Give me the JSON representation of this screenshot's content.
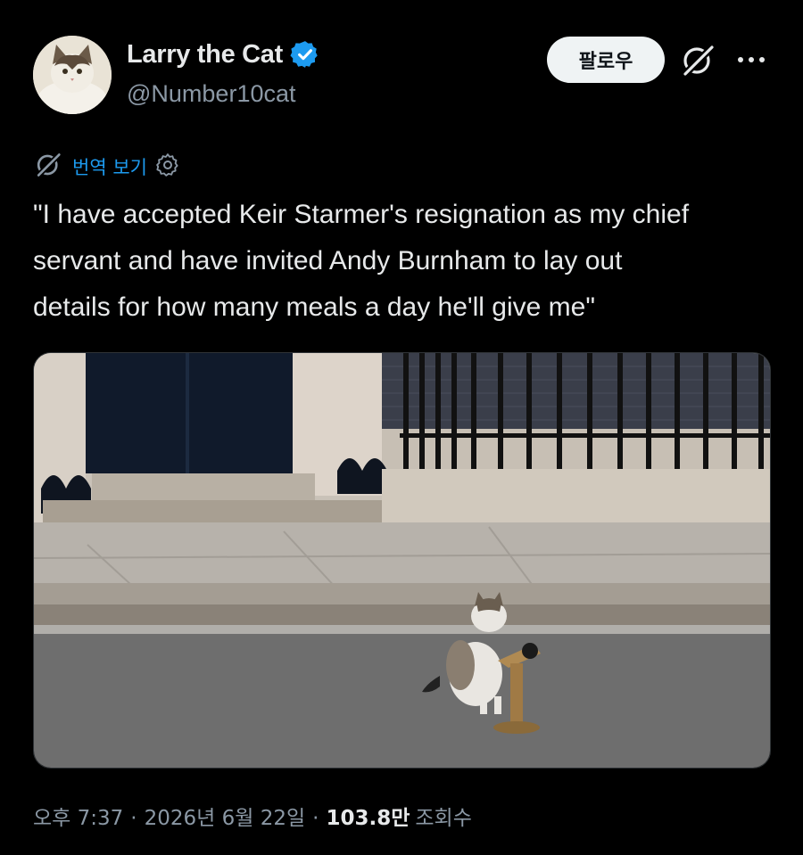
{
  "author": {
    "display_name": "Larry the Cat",
    "handle": "@Number10cat",
    "verified": true,
    "verified_color": "#1d9bf0"
  },
  "actions": {
    "follow_label": "팔로우",
    "grok_icon": "grok-icon",
    "more_icon": "more-dots-icon"
  },
  "translate": {
    "label": "번역 보기",
    "icon": "grok-icon",
    "settings_icon": "gear-icon"
  },
  "tweet": {
    "text": "\"I have accepted Keir Starmer's resignation as my chief\nservant and have invited Andy Burnham to lay out\ndetails for how many meals a day he'll give me\""
  },
  "media": {
    "alt": "photo-cat-at-podium-downing-street"
  },
  "meta": {
    "time": "오후 7:37",
    "separator": "·",
    "date": "2026년 6월 22일",
    "views_count": "103.8만",
    "views_label": "조회수"
  },
  "colors": {
    "background": "#000000",
    "text": "#e7e9ea",
    "secondary": "#8b98a5",
    "link": "#1d9bf0"
  }
}
